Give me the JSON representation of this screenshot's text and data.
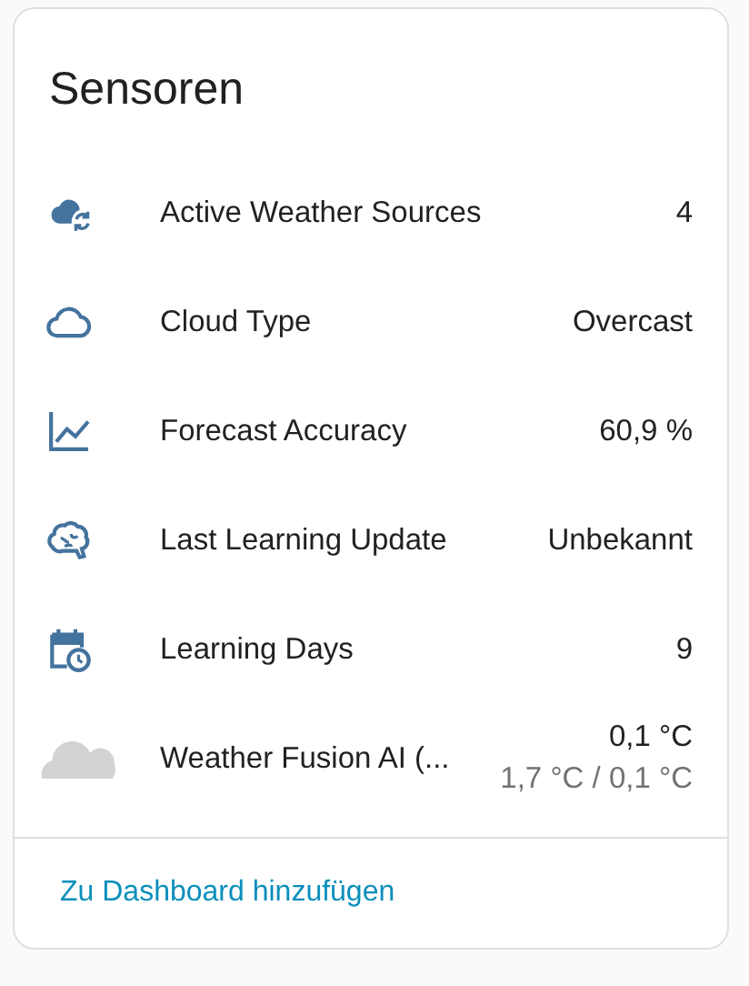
{
  "card": {
    "title": "Sensoren",
    "rows": [
      {
        "kind": "cloud-sync",
        "label": "Active Weather Sources",
        "value": "4"
      },
      {
        "kind": "cloud-outline",
        "label": "Cloud Type",
        "value": "Overcast"
      },
      {
        "kind": "chart",
        "label": "Forecast Accuracy",
        "value": "60,9 %"
      },
      {
        "kind": "brain",
        "label": "Last Learning Update",
        "value": "Unbekannt"
      },
      {
        "kind": "calendar",
        "label": "Learning Days",
        "value": "9"
      },
      {
        "kind": "weather",
        "label": "Weather Fusion AI (...",
        "value": "0,1 °C",
        "secondary": "1,7 °C / 0,1 °C"
      }
    ],
    "action": "Zu Dashboard hinzufügen"
  }
}
